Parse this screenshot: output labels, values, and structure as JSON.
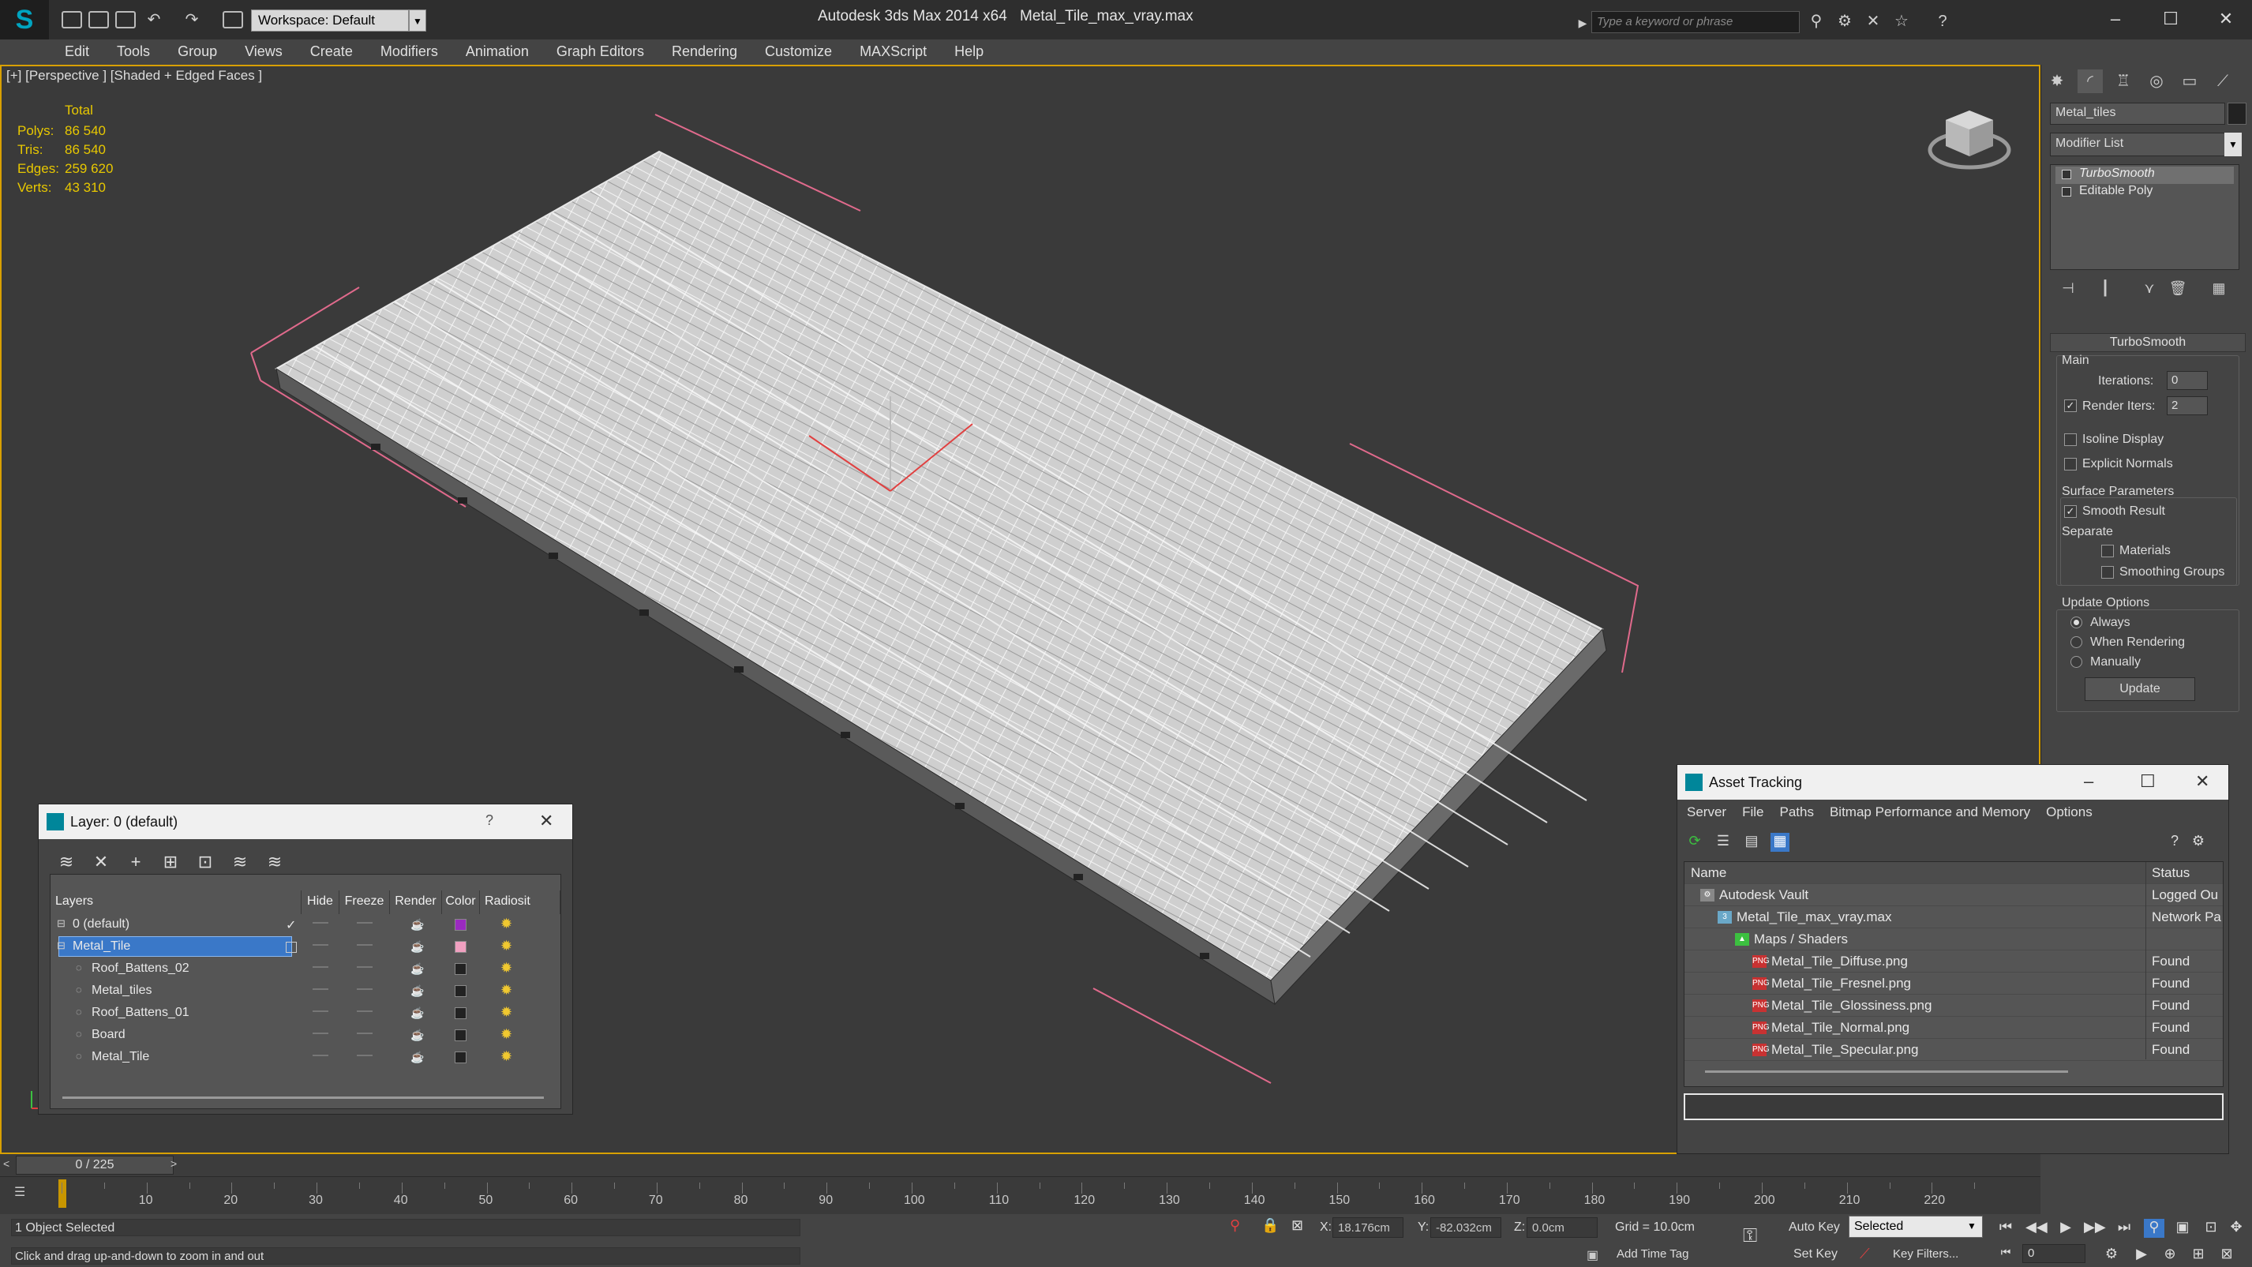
{
  "titlebar": {
    "workspace": "Workspace: Default",
    "app_title": "Autodesk 3ds Max  2014 x64",
    "file_title": "Metal_Tile_max_vray.max",
    "search_placeholder": "Type a keyword or phrase"
  },
  "menu": [
    "Edit",
    "Tools",
    "Group",
    "Views",
    "Create",
    "Modifiers",
    "Animation",
    "Graph Editors",
    "Rendering",
    "Customize",
    "MAXScript",
    "Help"
  ],
  "viewport": {
    "label": "[+] [Perspective ] [Shaded + Edged Faces ]",
    "stats_header": "Total",
    "stats": [
      {
        "key": "Polys:",
        "value": "86 540"
      },
      {
        "key": "Tris:",
        "value": "86 540"
      },
      {
        "key": "Edges:",
        "value": "259 620"
      },
      {
        "key": "Verts:",
        "value": "43 310"
      }
    ]
  },
  "command_panel": {
    "object_name": "Metal_tiles",
    "modifier_list": "Modifier List",
    "stack": [
      "TurboSmooth",
      "Editable Poly"
    ],
    "rollout_title": "TurboSmooth",
    "main_group": "Main",
    "iterations_label": "Iterations:",
    "iterations_value": "0",
    "render_iters_label": "Render Iters:",
    "render_iters_value": "2",
    "render_iters_checked": true,
    "isoline_label": "Isoline Display",
    "explicit_normals_label": "Explicit Normals",
    "surface_params_label": "Surface Parameters",
    "smooth_result_label": "Smooth Result",
    "separate_label": "Separate",
    "materials_label": "Materials",
    "smoothing_groups_label": "Smoothing Groups",
    "update_options_label": "Update Options",
    "update_always": "Always",
    "update_when_rendering": "When Rendering",
    "update_manually": "Manually",
    "update_button": "Update"
  },
  "layer_dialog": {
    "title": "Layer: 0 (default)",
    "help": "?",
    "columns": [
      "Layers",
      "Hide",
      "Freeze",
      "Render",
      "Color",
      "Radiosit"
    ],
    "rows": [
      {
        "name": "0 (default)",
        "indent": 1,
        "color": "#9a2ac0",
        "selected": false,
        "current": true
      },
      {
        "name": "Metal_Tile",
        "indent": 1,
        "color": "#f0a0c0",
        "selected": true,
        "current": false
      },
      {
        "name": "Roof_Battens_02",
        "indent": 2,
        "color": "#222222",
        "selected": false,
        "current": false
      },
      {
        "name": "Metal_tiles",
        "indent": 2,
        "color": "#222222",
        "selected": false,
        "current": false
      },
      {
        "name": "Roof_Battens_01",
        "indent": 2,
        "color": "#222222",
        "selected": false,
        "current": false
      },
      {
        "name": "Board",
        "indent": 2,
        "color": "#222222",
        "selected": false,
        "current": false
      },
      {
        "name": "Metal_Tile",
        "indent": 2,
        "color": "#222222",
        "selected": false,
        "current": false
      }
    ]
  },
  "asset_tracking": {
    "title": "Asset Tracking",
    "menu": [
      "Server",
      "File",
      "Paths",
      "Bitmap Performance and Memory",
      "Options"
    ],
    "col_name": "Name",
    "col_status": "Status",
    "rows": [
      {
        "name": "Autodesk Vault",
        "status": "Logged Ou",
        "indent": 1,
        "icon": "vault"
      },
      {
        "name": "Metal_Tile_max_vray.max",
        "status": "Network Pa",
        "indent": 2,
        "icon": "max"
      },
      {
        "name": "Maps / Shaders",
        "status": "",
        "indent": 3,
        "icon": "maps"
      },
      {
        "name": "Metal_Tile_Diffuse.png",
        "status": "Found",
        "indent": 4,
        "icon": "png"
      },
      {
        "name": "Metal_Tile_Fresnel.png",
        "status": "Found",
        "indent": 4,
        "icon": "png"
      },
      {
        "name": "Metal_Tile_Glossiness.png",
        "status": "Found",
        "indent": 4,
        "icon": "png"
      },
      {
        "name": "Metal_Tile_Normal.png",
        "status": "Found",
        "indent": 4,
        "icon": "png"
      },
      {
        "name": "Metal_Tile_Specular.png",
        "status": "Found",
        "indent": 4,
        "icon": "png"
      }
    ]
  },
  "timeline": {
    "frame_display": "0 / 225",
    "ticks": [
      "10",
      "20",
      "30",
      "40",
      "50",
      "60",
      "70",
      "80",
      "90",
      "100",
      "110",
      "120",
      "130",
      "140",
      "150",
      "160",
      "170",
      "180",
      "190",
      "200",
      "210",
      "220"
    ]
  },
  "statusbar": {
    "selection": "1 Object Selected",
    "prompt": "Click and drag up-and-down to zoom in and out",
    "x_label": "X:",
    "x_value": "18.176cm",
    "y_label": "Y:",
    "y_value": "-82.032cm",
    "z_label": "Z:",
    "z_value": "0.0cm",
    "grid": "Grid = 10.0cm",
    "add_time_tag": "Add Time Tag",
    "auto_key": "Auto Key",
    "set_key": "Set Key",
    "selected_dropdown": "Selected",
    "key_filters": "Key Filters...",
    "current_frame": "0"
  },
  "colors": {
    "accent": "#00869a",
    "viewport_border": "#d8a000",
    "stat_text": "#e8c800",
    "selection_blue": "#3a78c8"
  }
}
